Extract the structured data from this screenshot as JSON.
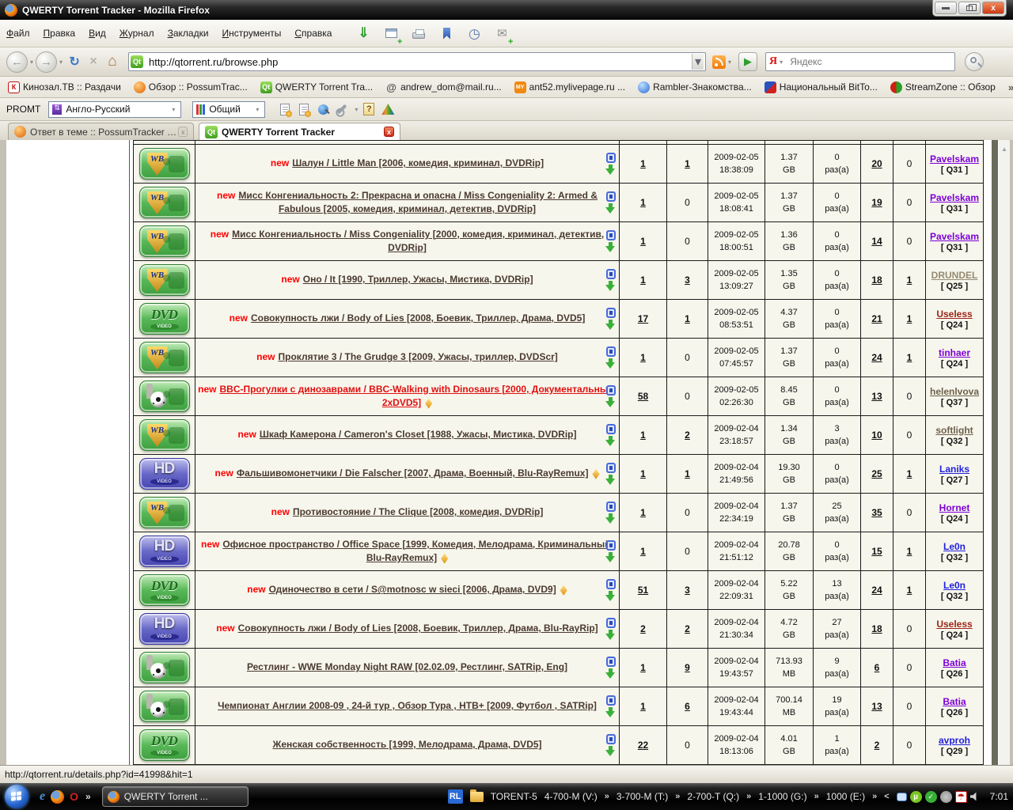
{
  "window": {
    "title": "QWERTY Torrent Tracker - Mozilla Firefox"
  },
  "menubar": {
    "items": [
      "Файл",
      "Правка",
      "Вид",
      "Журнал",
      "Закладки",
      "Инструменты",
      "Справка"
    ]
  },
  "icons": {
    "back": "←",
    "forward": "→",
    "reload": "↻",
    "stop": "×",
    "home": "⌂",
    "caret": "▾",
    "go": "▶",
    "up_arrow": "▲",
    "chevron": "»",
    "collapse": "<",
    "close": "x",
    "download_tool": "⇓",
    "mail_tool": "✉",
    "history_tool": "◷",
    "umbrella": "☂",
    "mu": "µ",
    "check": "✓",
    "search_engine_letter": "Я",
    "ie_letter": "e",
    "opera_letter": "O"
  },
  "navbar": {
    "url": "http://qtorrent.ru/browse.php",
    "search_placeholder": "Яндекс"
  },
  "bookmarks": {
    "overflow": "»",
    "items": [
      {
        "label": "Кинозал.ТВ :: Раздачи",
        "icon": "kinozal",
        "icon_text": "К"
      },
      {
        "label": "Обзор :: PossumTrac...",
        "icon": "possum",
        "icon_text": ""
      },
      {
        "label": "QWERTY Torrent Tra...",
        "icon": "qt",
        "icon_text": "Qt"
      },
      {
        "label": "andrew_dom@mail.ru...",
        "icon": "mail",
        "icon_text": "@"
      },
      {
        "label": "ant52.mylivepage.ru ...",
        "icon": "my",
        "icon_text": "MY"
      },
      {
        "label": "Rambler-Знакомства...",
        "icon": "rambler",
        "icon_text": ""
      },
      {
        "label": "Национальный BitTo...",
        "icon": "natbt",
        "icon_text": ""
      },
      {
        "label": "StreamZone :: Обзор",
        "icon": "stream",
        "icon_text": ""
      }
    ]
  },
  "promt": {
    "label": "PROMT",
    "direction": "Англо-Русский",
    "profile": "Общий"
  },
  "tabs": [
    {
      "label": "Ответ в теме :: PossumTracker @ Big...",
      "active": false
    },
    {
      "label": "QWERTY Torrent Tracker",
      "active": true
    }
  ],
  "qt_favicon_text": "Qt",
  "table": {
    "new_label": "new",
    "times_label": "раз(а)",
    "icon_labels": {
      "wb": "WB",
      "dvd": "DVD",
      "hd": "HD",
      "video": "VIDEO"
    },
    "rows": [
      {
        "cat": "wb",
        "is_new": true,
        "red": false,
        "gold": false,
        "title": "Шалун / Little Man [2006, комедия, криминал, DVDRip]",
        "seeders": "1",
        "leechers": "1",
        "date": "2009-02-05",
        "time": "18:38:09",
        "size": "1.37",
        "unit": "GB",
        "times": "0",
        "replies": "20",
        "num2": "0",
        "user": "Pavelskam",
        "user_color": "#7c00d8",
        "q": "[ Q31 ]"
      },
      {
        "cat": "wb",
        "is_new": true,
        "red": false,
        "gold": false,
        "title": "Мисс Конгениальность 2: Прекрасна и опасна / Miss Congeniality 2: Armed & Fabulous [2005, комедия, криминал, детектив, DVDRip]",
        "seeders": "1",
        "leechers": "0",
        "date": "2009-02-05",
        "time": "18:08:41",
        "size": "1.37",
        "unit": "GB",
        "times": "0",
        "replies": "19",
        "num2": "0",
        "user": "Pavelskam",
        "user_color": "#7c00d8",
        "q": "[ Q31 ]"
      },
      {
        "cat": "wb",
        "is_new": true,
        "red": false,
        "gold": false,
        "title": "Мисс Конгениальность / Miss Congeniality [2000, комедия, криминал, детектив, DVDRip]",
        "seeders": "1",
        "leechers": "0",
        "date": "2009-02-05",
        "time": "18:00:51",
        "size": "1.36",
        "unit": "GB",
        "times": "0",
        "replies": "14",
        "num2": "0",
        "user": "Pavelskam",
        "user_color": "#7c00d8",
        "q": "[ Q31 ]"
      },
      {
        "cat": "wb",
        "is_new": true,
        "red": false,
        "gold": false,
        "title": "Оно / It [1990, Триллер, Ужасы, Мистика, DVDRip]",
        "seeders": "1",
        "leechers": "3",
        "date": "2009-02-05",
        "time": "13:09:27",
        "size": "1.35",
        "unit": "GB",
        "times": "0",
        "replies": "18",
        "num2": "1",
        "user": "DRUNDEL",
        "user_color": "#948a70",
        "q": "[ Q25 ]"
      },
      {
        "cat": "dvd",
        "is_new": true,
        "red": false,
        "gold": false,
        "title": "Совокупность лжи / Body of Lies [2008, Боевик, Триллер, Драма, DVD5]",
        "seeders": "17",
        "leechers": "1",
        "date": "2009-02-05",
        "time": "08:53:51",
        "size": "4.37",
        "unit": "GB",
        "times": "0",
        "replies": "21",
        "num2": "1",
        "user": "Useless",
        "user_color": "#9c2418",
        "q": "[ Q24 ]"
      },
      {
        "cat": "wb",
        "is_new": true,
        "red": false,
        "gold": false,
        "title": "Проклятие 3 / The Grudge 3 [2009, Ужасы, триллер, DVDScr]",
        "seeders": "1",
        "leechers": "0",
        "date": "2009-02-05",
        "time": "07:45:57",
        "size": "1.37",
        "unit": "GB",
        "times": "0",
        "replies": "24",
        "num2": "1",
        "user": "tinhaer",
        "user_color": "#7c00d8",
        "q": "[ Q24 ]"
      },
      {
        "cat": "sport",
        "is_new": true,
        "red": true,
        "gold": true,
        "title": "BBC-Прогулки с динозаврами / BBC-Walking with Dinosaurs [2000, Документальный, 2xDVD5]",
        "seeders": "58",
        "leechers": "0",
        "date": "2009-02-05",
        "time": "02:26:30",
        "size": "8.45",
        "unit": "GB",
        "times": "0",
        "replies": "13",
        "num2": "0",
        "user": "helenlvova",
        "user_color": "#6d604c",
        "q": "[ Q37 ]"
      },
      {
        "cat": "wb",
        "is_new": true,
        "red": false,
        "gold": false,
        "title": "Шкаф Камерона / Cameron's Closet [1988, Ужасы, Мистика, DVDRip]",
        "seeders": "1",
        "leechers": "2",
        "date": "2009-02-04",
        "time": "23:18:57",
        "size": "1.34",
        "unit": "GB",
        "times": "3",
        "replies": "10",
        "num2": "0",
        "user": "softlight",
        "user_color": "#6d604c",
        "q": "[ Q32 ]"
      },
      {
        "cat": "hd",
        "is_new": true,
        "red": false,
        "gold": true,
        "title": "Фальшивомонетчики / Die Falscher [2007, Драма, Военный, Blu-RayRemux]",
        "seeders": "1",
        "leechers": "1",
        "date": "2009-02-04",
        "time": "21:49:56",
        "size": "19.30",
        "unit": "GB",
        "times": "0",
        "replies": "25",
        "num2": "1",
        "user": "Laniks",
        "user_color": "#2020dd",
        "q": "[ Q27 ]"
      },
      {
        "cat": "wb",
        "is_new": true,
        "red": false,
        "gold": false,
        "title": "Противостояние / The Clique [2008, комедия, DVDRip]",
        "seeders": "1",
        "leechers": "0",
        "date": "2009-02-04",
        "time": "22:34:19",
        "size": "1.37",
        "unit": "GB",
        "times": "25",
        "replies": "35",
        "num2": "0",
        "user": "Hornet",
        "user_color": "#7c00d8",
        "q": "[ Q24 ]"
      },
      {
        "cat": "hd",
        "is_new": true,
        "red": false,
        "gold": true,
        "title": "Офисное пространство / Office Space [1999, Комедия, Мелодрама, Криминальный, Blu-RayRemux]",
        "seeders": "1",
        "leechers": "0",
        "date": "2009-02-04",
        "time": "21:51:12",
        "size": "20.78",
        "unit": "GB",
        "times": "0",
        "replies": "15",
        "num2": "1",
        "user": "Le0n",
        "user_color": "#2020dd",
        "q": "[ Q32 ]"
      },
      {
        "cat": "dvd",
        "is_new": true,
        "red": false,
        "gold": true,
        "title": "Одиночество в сети / S@motnosc w sieci [2006, Драма, DVD9]",
        "seeders": "51",
        "leechers": "3",
        "date": "2009-02-04",
        "time": "22:09:31",
        "size": "5.22",
        "unit": "GB",
        "times": "13",
        "replies": "24",
        "num2": "1",
        "user": "Le0n",
        "user_color": "#2020dd",
        "q": "[ Q32 ]"
      },
      {
        "cat": "hd",
        "is_new": true,
        "red": false,
        "gold": false,
        "title": "Совокупность лжи / Body of Lies [2008, Боевик, Триллер, Драма, Blu-RayRip]",
        "seeders": "2",
        "leechers": "2",
        "date": "2009-02-04",
        "time": "21:30:34",
        "size": "4.72",
        "unit": "GB",
        "times": "27",
        "replies": "18",
        "num2": "0",
        "user": "Useless",
        "user_color": "#9c2418",
        "q": "[ Q24 ]"
      },
      {
        "cat": "sport",
        "is_new": false,
        "red": false,
        "gold": false,
        "title": "Рестлинг - WWE Monday Night RAW [02.02.09, Рестлинг, SATRip, Eng]",
        "seeders": "1",
        "leechers": "9",
        "date": "2009-02-04",
        "time": "19:43:57",
        "size": "713.93",
        "unit": "MB",
        "times": "9",
        "replies": "6",
        "num2": "0",
        "user": "Batia",
        "user_color": "#7c00d8",
        "q": "[ Q26 ]"
      },
      {
        "cat": "sport",
        "is_new": false,
        "red": false,
        "gold": false,
        "title": "Чемпионат Англии 2008-09 , 24-й тур , Обзор Тура , НТВ+ [2009, Футбол , SATRip]",
        "seeders": "1",
        "leechers": "6",
        "date": "2009-02-04",
        "time": "19:43:44",
        "size": "700.14",
        "unit": "MB",
        "times": "19",
        "replies": "13",
        "num2": "0",
        "user": "Batia",
        "user_color": "#7c00d8",
        "q": "[ Q26 ]"
      },
      {
        "cat": "dvd",
        "is_new": false,
        "red": false,
        "gold": false,
        "title": "Женская собственность [1999, Мелодрама, Драма, DVD5]",
        "seeders": "22",
        "leechers": "0",
        "date": "2009-02-04",
        "time": "18:13:06",
        "size": "4.01",
        "unit": "GB",
        "times": "1",
        "replies": "2",
        "num2": "0",
        "user": "avproh",
        "user_color": "#2020dd",
        "q": "[ Q29 ]"
      }
    ]
  },
  "statusbar": {
    "link_url": "http://qtorrent.ru/details.php?id=41998&hit=1"
  },
  "taskbar": {
    "task_button": "QWERTY Torrent ...",
    "lang_badge": "RL",
    "folder_label": "TORENT-5",
    "drives": [
      "4-700-M (V:)",
      "3-700-M (T:)",
      "2-700-T (Q:)",
      "1-1000 (G:)",
      "1000  (E:)"
    ],
    "clock": "7:01"
  }
}
